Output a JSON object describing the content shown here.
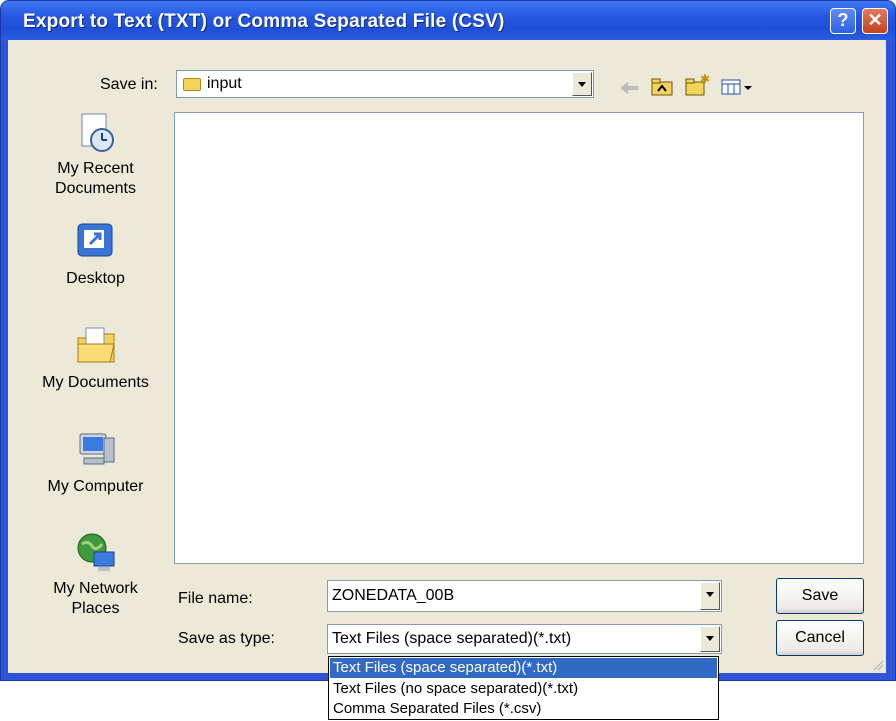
{
  "window": {
    "title": "Export to Text (TXT) or Comma Separated File (CSV)",
    "help_label": "?",
    "close_label": "✕"
  },
  "save_in": {
    "label": "Save in:",
    "value": "input"
  },
  "places": [
    {
      "label": "My Recent Documents",
      "icon": "recent-documents-icon"
    },
    {
      "label": "Desktop",
      "icon": "desktop-icon"
    },
    {
      "label": "My Documents",
      "icon": "my-documents-icon"
    },
    {
      "label": "My Computer",
      "icon": "my-computer-icon"
    },
    {
      "label": "My Network Places",
      "icon": "network-places-icon"
    }
  ],
  "file_name": {
    "label": "File name:",
    "value": "ZONEDATA_00B"
  },
  "save_as_type": {
    "label": "Save as type:",
    "value": "Text Files (space separated)(*.txt)",
    "options": [
      "Text Files (space separated)(*.txt)",
      "Text Files (no space separated)(*.txt)",
      "Comma Separated Files (*.csv)"
    ],
    "selected_index": 0
  },
  "buttons": {
    "save": "Save",
    "cancel": "Cancel"
  },
  "colors": {
    "titlebar": "#2557e3",
    "dialog_bg": "#ece9d8",
    "selection": "#316ac5"
  }
}
